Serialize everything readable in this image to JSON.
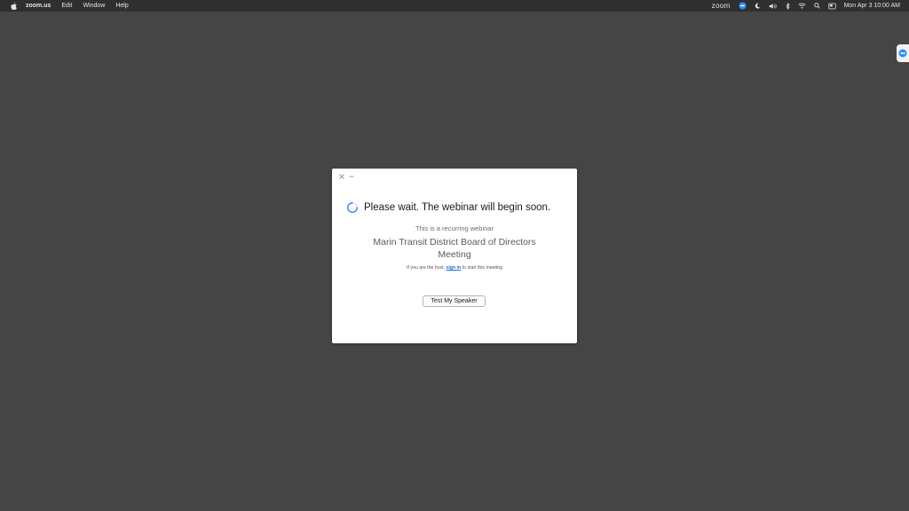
{
  "menubar": {
    "apple_icon": "apple-icon",
    "app_name": "zoom.us",
    "menus": [
      "Edit",
      "Window",
      "Help"
    ],
    "status": {
      "zoom_label": "zoom",
      "icons": [
        "teamviewer-icon",
        "moon-icon",
        "volume-icon",
        "bluetooth-icon",
        "wifi-icon",
        "search-icon",
        "display-icon"
      ],
      "clock": "Mon Apr 3 10:00 AM"
    }
  },
  "dialog": {
    "controls": [
      "close-icon",
      "minimize-icon"
    ],
    "headline": "Please wait. The webinar will begin soon.",
    "recurring_text": "This is a recurring webinar",
    "meeting_title": "Marin Transit District Board of Directors Meeting",
    "host_prefix": "If you are the host,",
    "sign_in_link": "sign in",
    "host_suffix": "to start this meeting",
    "test_speaker_button": "Test My Speaker"
  },
  "colors": {
    "desktop": "#444544",
    "menubar": "#2e2f2e",
    "link": "#1f6fd0",
    "spinner": "#2d8cff"
  }
}
